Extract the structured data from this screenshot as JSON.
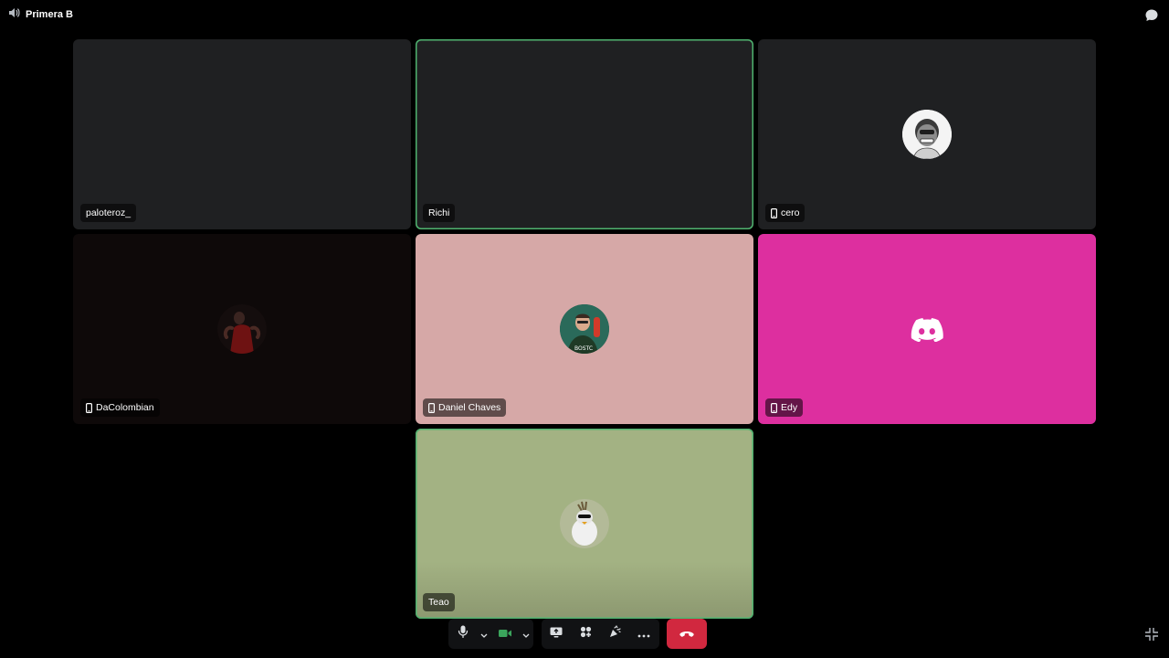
{
  "channel": {
    "name": "Primera B",
    "icon": "speaker-icon"
  },
  "participants": [
    {
      "name": "paloteroz_",
      "mobile": false,
      "speaking": false
    },
    {
      "name": "Richi",
      "mobile": false,
      "speaking": true
    },
    {
      "name": "cero",
      "mobile": true,
      "speaking": false
    },
    {
      "name": "DaColombian",
      "mobile": true,
      "speaking": false
    },
    {
      "name": "Daniel Chaves",
      "mobile": true,
      "speaking": false
    },
    {
      "name": "Edy",
      "mobile": true,
      "speaking": false
    },
    {
      "name": "Teao",
      "mobile": false,
      "speaking": true
    }
  ],
  "colors": {
    "tile_dark": "#1f2022",
    "tile_dacolombian": "#0e0909",
    "tile_daniel": "#d6a8a7",
    "tile_edy": "#dd2f9f",
    "tile_teao": "#a3b283",
    "speaking_ring": "#4fb36f",
    "hangup": "#d1283f",
    "camera_on": "#3ba55c"
  },
  "controls": {
    "mic": "microphone-icon",
    "mic_options": "chevron-down-icon",
    "camera": "video-camera-icon",
    "camera_options": "chevron-down-icon",
    "share": "screen-share-icon",
    "activities": "activities-icon",
    "soundboard": "soundboard-icon",
    "more": "more-icon",
    "disconnect": "phone-hangup-icon",
    "fullscreen": "exit-fullscreen-icon"
  }
}
